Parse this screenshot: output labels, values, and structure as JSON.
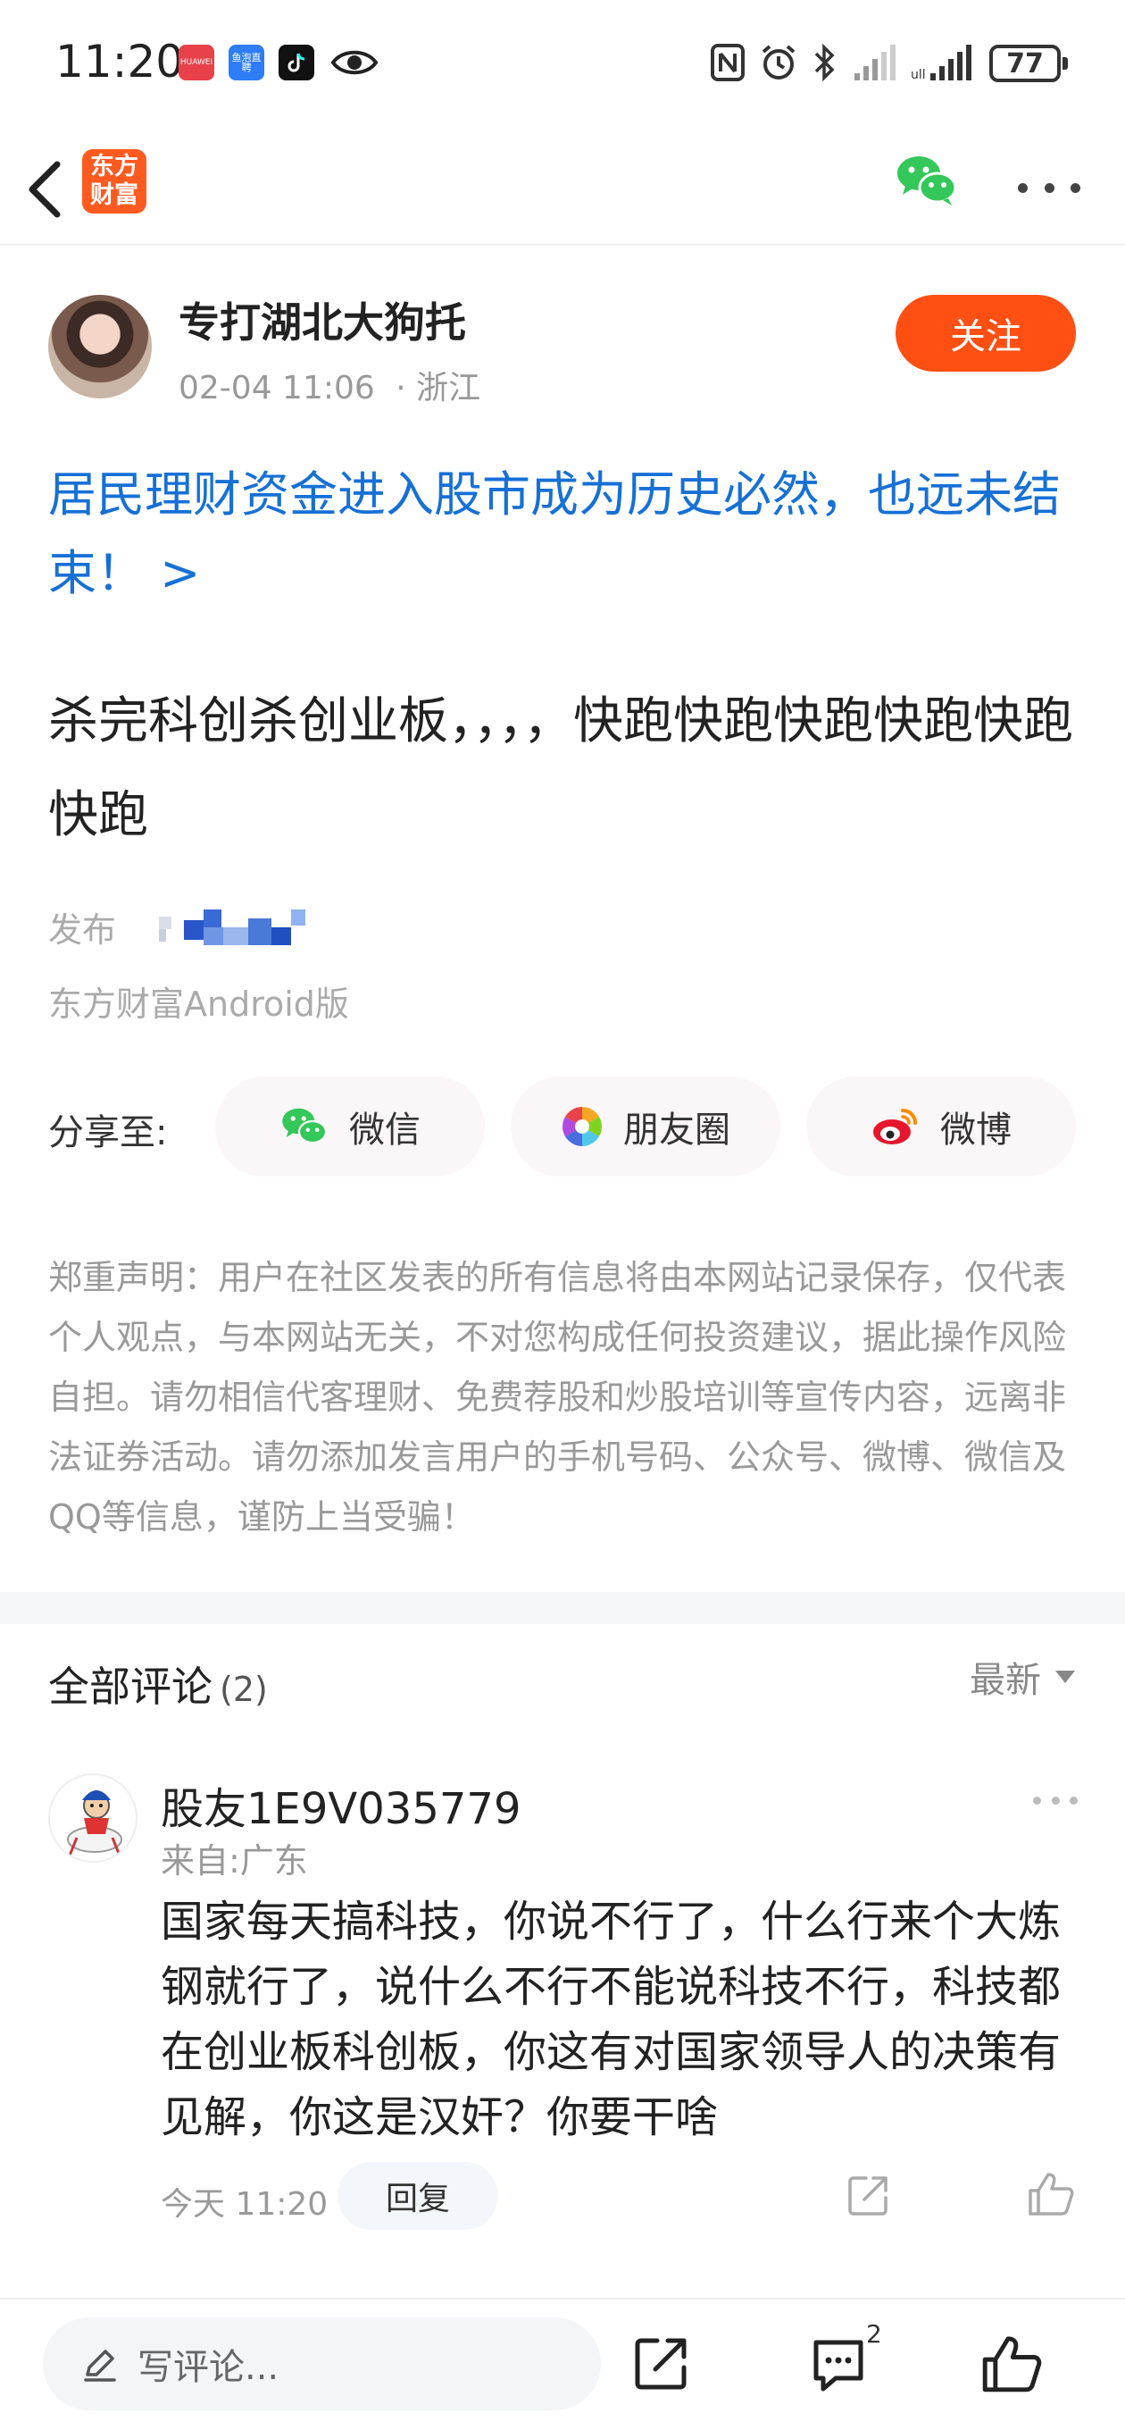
{
  "status_bar": {
    "time": "11:20",
    "apps": [
      "HUAWEI",
      "鱼泡直聘"
    ],
    "battery": "77"
  },
  "header": {
    "logo_text": "东方财富"
  },
  "author": {
    "name": "专打湖北大狗托",
    "datetime": "02-04 11:06",
    "location": "· 浙江",
    "follow_label": "关注"
  },
  "post": {
    "topic": "居民理财资金进入股市成为历史必然，也远未结束！ >",
    "body": "杀完科创杀创业板，，，，快跑快跑快跑快跑快跑快跑",
    "publish_prefix": "发布",
    "source": "东方财富Android版"
  },
  "share": {
    "label": "分享至:",
    "buttons": [
      {
        "label": "微信",
        "icon": "wechat-icon"
      },
      {
        "label": "朋友圈",
        "icon": "moments-icon"
      },
      {
        "label": "微博",
        "icon": "weibo-icon"
      }
    ]
  },
  "disclaimer": "郑重声明：用户在社区发表的所有信息将由本网站记录保存，仅代表个人观点，与本网站无关，不对您构成任何投资建议，据此操作风险自担。请勿相信代客理财、免费荐股和炒股培训等宣传内容，远离非法证券活动。请勿添加发言用户的手机号码、公众号、微博、微信及QQ等信息，谨防上当受骗！",
  "comments_section": {
    "title": "全部评论",
    "count": "(2)",
    "sort": "最新",
    "items": [
      {
        "user": "股友1E9V035779",
        "location": "来自:广东",
        "text": "国家每天搞科技，你说不行了，什么行来个大炼钢就行了，说什么不行不能说科技不行，科技都在创业板科创板，你这有对国家领导人的决策有见解，你这是汉奸？你要干啥",
        "time": "今天 11:20",
        "reply_label": "回复"
      }
    ]
  },
  "bottom_bar": {
    "comment_placeholder": "写评论...",
    "comment_count": "2"
  },
  "colors": {
    "accent": "#ff4f12",
    "link": "#1670d6"
  }
}
